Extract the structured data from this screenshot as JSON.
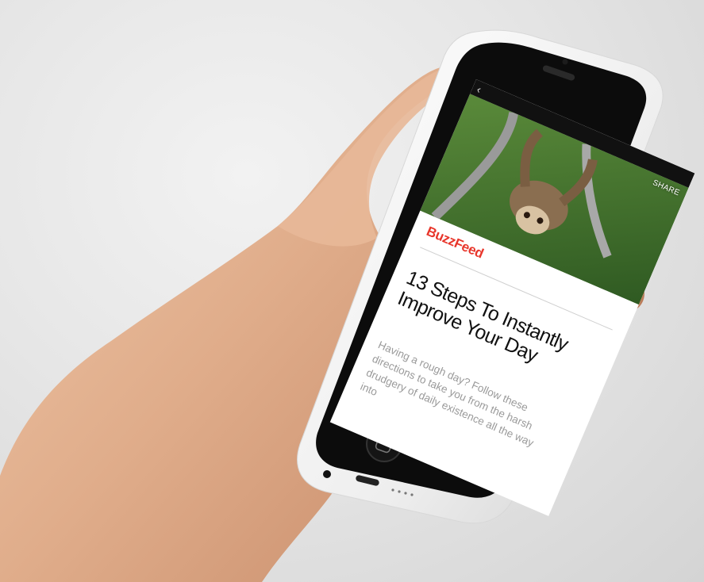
{
  "app": {
    "back_label": "‹",
    "share_label": "SHARE",
    "brand": "BuzzFeed",
    "headline": "13 Steps To Instantly Improve Your Day",
    "excerpt": "Having a rough day? Follow these directions to take you from the harsh drudgery of daily existence all the way into",
    "hero_icon": "sloth-photo"
  },
  "colors": {
    "brand_red": "#e8362b",
    "phone_shell": "#f4f4f4",
    "bezel": "#0c0c0c"
  }
}
